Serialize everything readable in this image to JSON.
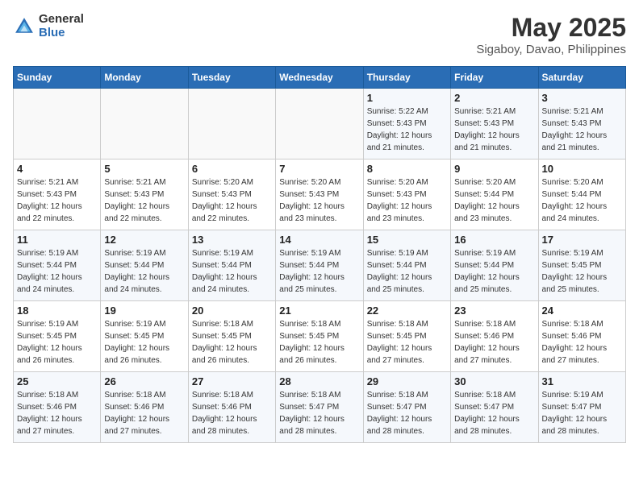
{
  "header": {
    "logo_general": "General",
    "logo_blue": "Blue",
    "month": "May 2025",
    "location": "Sigaboy, Davao, Philippines"
  },
  "weekdays": [
    "Sunday",
    "Monday",
    "Tuesday",
    "Wednesday",
    "Thursday",
    "Friday",
    "Saturday"
  ],
  "weeks": [
    [
      {
        "day": "",
        "info": ""
      },
      {
        "day": "",
        "info": ""
      },
      {
        "day": "",
        "info": ""
      },
      {
        "day": "",
        "info": ""
      },
      {
        "day": "1",
        "info": "Sunrise: 5:22 AM\nSunset: 5:43 PM\nDaylight: 12 hours\nand 21 minutes."
      },
      {
        "day": "2",
        "info": "Sunrise: 5:21 AM\nSunset: 5:43 PM\nDaylight: 12 hours\nand 21 minutes."
      },
      {
        "day": "3",
        "info": "Sunrise: 5:21 AM\nSunset: 5:43 PM\nDaylight: 12 hours\nand 21 minutes."
      }
    ],
    [
      {
        "day": "4",
        "info": "Sunrise: 5:21 AM\nSunset: 5:43 PM\nDaylight: 12 hours\nand 22 minutes."
      },
      {
        "day": "5",
        "info": "Sunrise: 5:21 AM\nSunset: 5:43 PM\nDaylight: 12 hours\nand 22 minutes."
      },
      {
        "day": "6",
        "info": "Sunrise: 5:20 AM\nSunset: 5:43 PM\nDaylight: 12 hours\nand 22 minutes."
      },
      {
        "day": "7",
        "info": "Sunrise: 5:20 AM\nSunset: 5:43 PM\nDaylight: 12 hours\nand 23 minutes."
      },
      {
        "day": "8",
        "info": "Sunrise: 5:20 AM\nSunset: 5:43 PM\nDaylight: 12 hours\nand 23 minutes."
      },
      {
        "day": "9",
        "info": "Sunrise: 5:20 AM\nSunset: 5:44 PM\nDaylight: 12 hours\nand 23 minutes."
      },
      {
        "day": "10",
        "info": "Sunrise: 5:20 AM\nSunset: 5:44 PM\nDaylight: 12 hours\nand 24 minutes."
      }
    ],
    [
      {
        "day": "11",
        "info": "Sunrise: 5:19 AM\nSunset: 5:44 PM\nDaylight: 12 hours\nand 24 minutes."
      },
      {
        "day": "12",
        "info": "Sunrise: 5:19 AM\nSunset: 5:44 PM\nDaylight: 12 hours\nand 24 minutes."
      },
      {
        "day": "13",
        "info": "Sunrise: 5:19 AM\nSunset: 5:44 PM\nDaylight: 12 hours\nand 24 minutes."
      },
      {
        "day": "14",
        "info": "Sunrise: 5:19 AM\nSunset: 5:44 PM\nDaylight: 12 hours\nand 25 minutes."
      },
      {
        "day": "15",
        "info": "Sunrise: 5:19 AM\nSunset: 5:44 PM\nDaylight: 12 hours\nand 25 minutes."
      },
      {
        "day": "16",
        "info": "Sunrise: 5:19 AM\nSunset: 5:44 PM\nDaylight: 12 hours\nand 25 minutes."
      },
      {
        "day": "17",
        "info": "Sunrise: 5:19 AM\nSunset: 5:45 PM\nDaylight: 12 hours\nand 25 minutes."
      }
    ],
    [
      {
        "day": "18",
        "info": "Sunrise: 5:19 AM\nSunset: 5:45 PM\nDaylight: 12 hours\nand 26 minutes."
      },
      {
        "day": "19",
        "info": "Sunrise: 5:19 AM\nSunset: 5:45 PM\nDaylight: 12 hours\nand 26 minutes."
      },
      {
        "day": "20",
        "info": "Sunrise: 5:18 AM\nSunset: 5:45 PM\nDaylight: 12 hours\nand 26 minutes."
      },
      {
        "day": "21",
        "info": "Sunrise: 5:18 AM\nSunset: 5:45 PM\nDaylight: 12 hours\nand 26 minutes."
      },
      {
        "day": "22",
        "info": "Sunrise: 5:18 AM\nSunset: 5:45 PM\nDaylight: 12 hours\nand 27 minutes."
      },
      {
        "day": "23",
        "info": "Sunrise: 5:18 AM\nSunset: 5:46 PM\nDaylight: 12 hours\nand 27 minutes."
      },
      {
        "day": "24",
        "info": "Sunrise: 5:18 AM\nSunset: 5:46 PM\nDaylight: 12 hours\nand 27 minutes."
      }
    ],
    [
      {
        "day": "25",
        "info": "Sunrise: 5:18 AM\nSunset: 5:46 PM\nDaylight: 12 hours\nand 27 minutes."
      },
      {
        "day": "26",
        "info": "Sunrise: 5:18 AM\nSunset: 5:46 PM\nDaylight: 12 hours\nand 27 minutes."
      },
      {
        "day": "27",
        "info": "Sunrise: 5:18 AM\nSunset: 5:46 PM\nDaylight: 12 hours\nand 28 minutes."
      },
      {
        "day": "28",
        "info": "Sunrise: 5:18 AM\nSunset: 5:47 PM\nDaylight: 12 hours\nand 28 minutes."
      },
      {
        "day": "29",
        "info": "Sunrise: 5:18 AM\nSunset: 5:47 PM\nDaylight: 12 hours\nand 28 minutes."
      },
      {
        "day": "30",
        "info": "Sunrise: 5:18 AM\nSunset: 5:47 PM\nDaylight: 12 hours\nand 28 minutes."
      },
      {
        "day": "31",
        "info": "Sunrise: 5:19 AM\nSunset: 5:47 PM\nDaylight: 12 hours\nand 28 minutes."
      }
    ]
  ]
}
